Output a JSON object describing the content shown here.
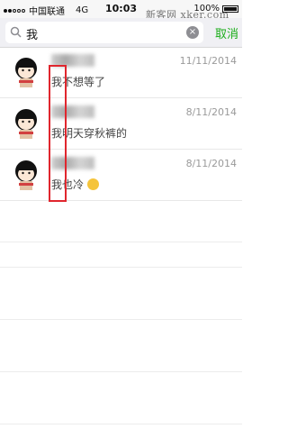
{
  "status": {
    "carrier": "中国联通",
    "network": "4G",
    "time": "10:03",
    "battery": "100%"
  },
  "watermark": "新客网 xker.com",
  "search": {
    "query": "我",
    "cancel_label": "取消"
  },
  "results": [
    {
      "date": "11/11/2014",
      "message": "我不想等了"
    },
    {
      "date": "8/11/2014",
      "message": "我明天穿秋裤的"
    },
    {
      "date": "8/11/2014",
      "message": "我也冷"
    }
  ],
  "colors": {
    "accent": "#1aad19",
    "highlight": "#e0262e"
  }
}
